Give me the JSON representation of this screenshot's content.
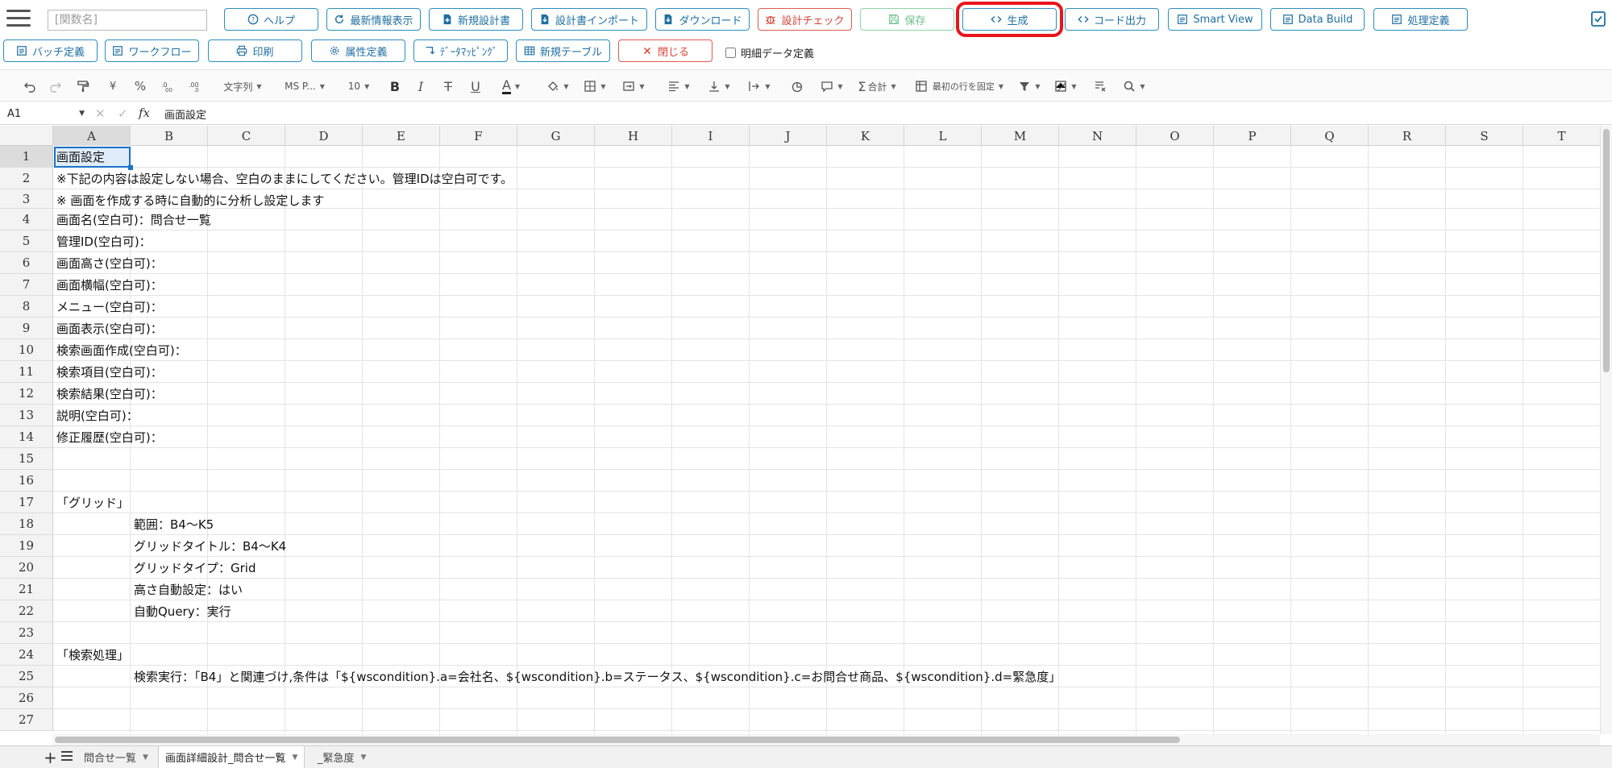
{
  "topbar": {
    "function_name_placeholder": "[関数名]",
    "row1_buttons": [
      {
        "label": "ヘルプ"
      },
      {
        "label": "最新情報表示"
      },
      {
        "label": "新規設計書"
      },
      {
        "label": "設計書インポート"
      },
      {
        "label": "ダウンロード"
      },
      {
        "label": "設計チェック"
      },
      {
        "label": "保存"
      },
      {
        "label": "生成"
      },
      {
        "label": "コード出力"
      },
      {
        "label": "Smart View"
      },
      {
        "label": "Data Build"
      },
      {
        "label": "処理定義"
      }
    ],
    "row2_buttons": [
      {
        "label": "バッチ定義"
      },
      {
        "label": "ワークフロー"
      },
      {
        "label": "印刷"
      },
      {
        "label": "属性定義"
      },
      {
        "label": "ﾃﾞｰﾀﾏｯﾋﾟﾝｸﾞ"
      },
      {
        "label": "新規テーブル"
      },
      {
        "label": "閉じる"
      }
    ],
    "detail_checkbox_label": "明細データ定義",
    "highlight_color": "#e8151b",
    "accent_color": "#2a8fbf"
  },
  "toolbar": {
    "currency": "¥",
    "percent": "%",
    "number_format": "文字列",
    "font_name": "MS P...",
    "font_size": "10",
    "bold": "B",
    "italic": "I",
    "strike": "T",
    "underline": "U",
    "font_color": "A",
    "sum": "合計",
    "freeze": "最初の行を固定"
  },
  "formula_bar": {
    "cell_ref": "A1",
    "fx": "fx",
    "content": "画面設定"
  },
  "columns": [
    "A",
    "B",
    "C",
    "D",
    "E",
    "F",
    "G",
    "H",
    "I",
    "J",
    "K",
    "L",
    "M",
    "N",
    "O",
    "P",
    "Q",
    "R",
    "S",
    "T"
  ],
  "rows": [
    "1",
    "2",
    "3",
    "4",
    "5",
    "6",
    "7",
    "8",
    "9",
    "10",
    "11",
    "12",
    "13",
    "14",
    "15",
    "16",
    "17",
    "18",
    "19",
    "20",
    "21",
    "22",
    "23",
    "24",
    "25",
    "26",
    "27"
  ],
  "cells": {
    "r1": "画面設定",
    "r2": "※下記の内容は設定しない場合、空白のままにしてください。管理IDは空白可です。",
    "r3": "※ 画面を作成する時に自動的に分析し設定します",
    "r4": "画面名(空白可)：問合せ一覧",
    "r5": "管理ID(空白可)：",
    "r6": "画面高さ(空白可)：",
    "r7": "画面横幅(空白可)：",
    "r8": "メニュー(空白可)：",
    "r9": "画面表示(空白可)：",
    "r10": "検索画面作成(空白可)：",
    "r11": "検索項目(空白可)：",
    "r12": "検索結果(空白可)：",
    "r13": "説明(空白可)：",
    "r14": "修正履歴(空白可)：",
    "r17": "「グリッド」",
    "r18": "範囲：B4～K5",
    "r19": "グリッドタイトル：B4～K4",
    "r20": "グリッドタイプ：Grid",
    "r21": "高さ自動設定：はい",
    "r22": "自動Query：実行",
    "r24": "「検索処理」",
    "r25": "検索実行：「B4」と関連づけ,条件は「${wscondition}.a=会社名、${wscondition}.b=ステータス、${wscondition}.c=お問合せ商品、${wscondition}.d=緊急度」"
  },
  "sheet_tabs": [
    {
      "label": "問合せ一覧"
    },
    {
      "label": "画面詳細設計_問合せ一覧"
    },
    {
      "label": "_緊急度"
    }
  ]
}
